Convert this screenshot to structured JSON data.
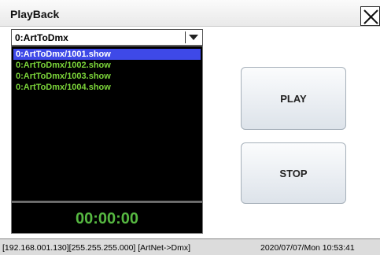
{
  "window": {
    "title": "PlayBack"
  },
  "dropdown": {
    "selected": "0:ArtToDmx"
  },
  "list": {
    "items": [
      {
        "label": "0:ArtToDmx/1001.show",
        "selected": true
      },
      {
        "label": "0:ArtToDmx/1002.show",
        "selected": false
      },
      {
        "label": "0:ArtToDmx/1003.show",
        "selected": false
      },
      {
        "label": "0:ArtToDmx/1004.show",
        "selected": false
      }
    ]
  },
  "timer": "00:00:00",
  "buttons": {
    "play": "PLAY",
    "stop": "STOP"
  },
  "status": {
    "network": "[192.168.001.130][255.255.255.000] [ArtNet->Dmx]",
    "datetime": "2020/07/07/Mon  10:53:41"
  },
  "colors": {
    "list_text": "#7cd63a",
    "selection": "#3e49e8",
    "timer_text": "#56b841"
  },
  "icons": {
    "close": "close-x-icon",
    "dropdown": "chevron-down-icon"
  }
}
